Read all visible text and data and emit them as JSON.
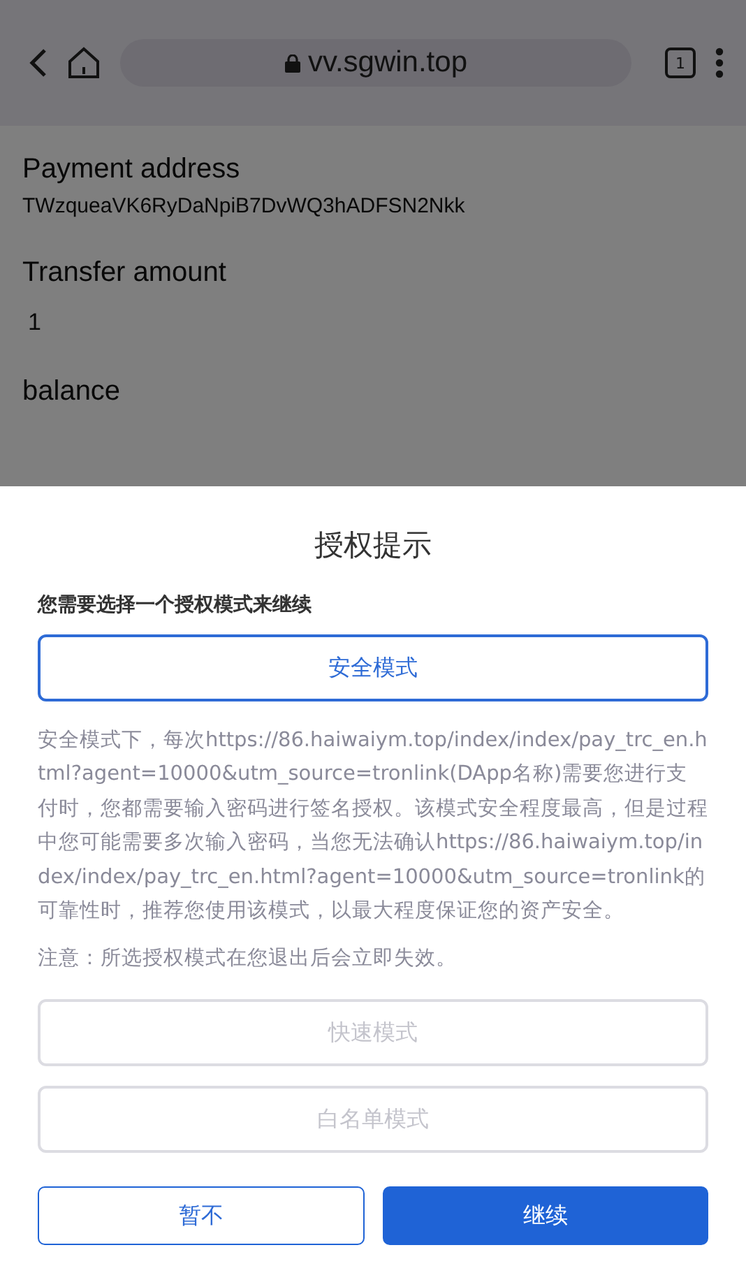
{
  "browser": {
    "url": "vv.sgwin.top",
    "tab_count": "1"
  },
  "page": {
    "fields": [
      {
        "label": "Payment address",
        "value": "TWzqueaVK6RyDaNpiB7DvWQ3hADFSN2Nkk"
      },
      {
        "label": "Transfer amount",
        "value": "1"
      },
      {
        "label": "balance"
      }
    ]
  },
  "dialog": {
    "title": "授权提示",
    "subtitle": "您需要选择一个授权模式来继续",
    "modes": [
      {
        "label": "安全模式",
        "selected": true
      }
    ],
    "description": "安全模式下，每次https://86.haiwaiym.top/index/index/pay_trc_en.html?agent=10000&utm_source=tronlink(DApp名称)需要您进行支付时，您都需要输入密码进行签名授权。该模式安全程度最高，但是过程中您可能需要多次输入密码，当您无法确认https://86.haiwaiym.top/index/index/pay_trc_en.html?agent=10000&utm_source=tronlink的可靠性时，推荐您使用该模式，以最大程度保证您的资产安全。",
    "note": "注意：所选授权模式在您退出后会立即失效。",
    "other_modes": [
      {
        "label": "快速模式",
        "disabled": true
      },
      {
        "label": "白名单模式",
        "disabled": true
      }
    ],
    "buttons": [
      {
        "label": "暂不",
        "kind": "secondary"
      },
      {
        "label": "继续",
        "kind": "primary"
      }
    ]
  }
}
